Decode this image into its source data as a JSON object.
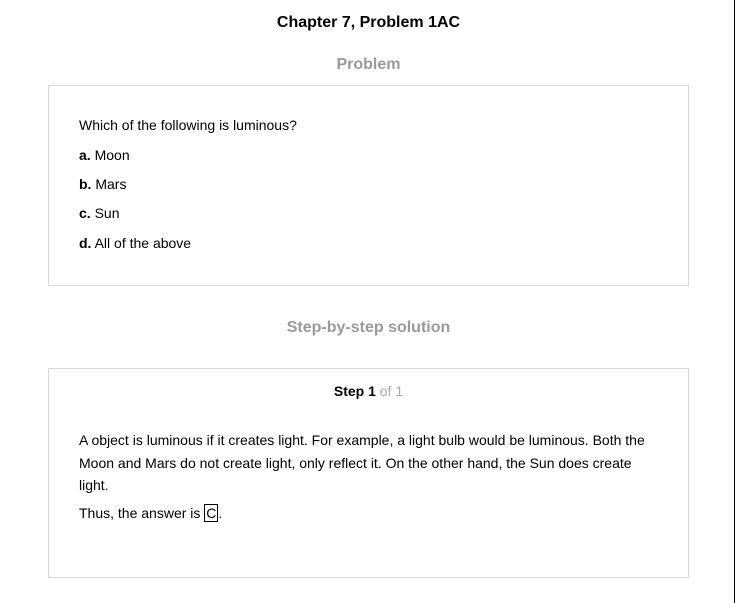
{
  "page": {
    "chapter_title": "Chapter 7, Problem 1AC"
  },
  "problem": {
    "heading": "Problem",
    "question": "Which of the following is luminous?",
    "options": [
      {
        "letter": "a.",
        "text": "Moon"
      },
      {
        "letter": "b.",
        "text": "Mars"
      },
      {
        "letter": "c.",
        "text": "Sun"
      },
      {
        "letter": "d.",
        "text": "All of the above"
      }
    ]
  },
  "solution": {
    "heading": "Step-by-step solution",
    "step_label": "Step 1",
    "step_of": "of 1",
    "explanation": "A object is luminous if it creates light. For example, a light bulb would be luminous. Both the Moon and Mars do not create light, only reflect it. On the other hand, the Sun does create light.",
    "answer_prefix": "Thus, the answer is",
    "answer": "C",
    "answer_suffix": "."
  }
}
